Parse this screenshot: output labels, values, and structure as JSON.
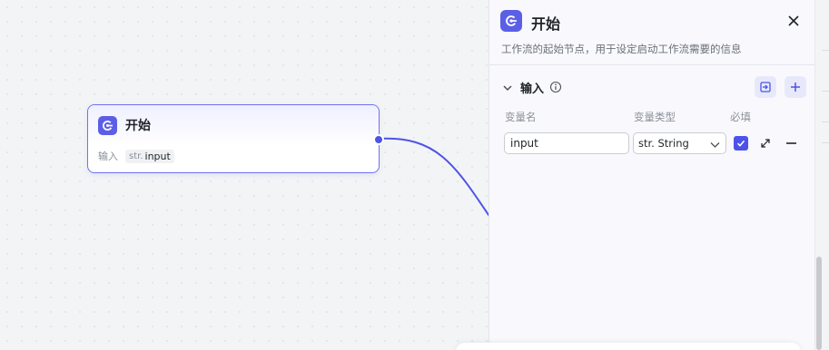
{
  "node": {
    "title": "开始",
    "input_label": "输入",
    "tag_type": "str.",
    "tag_name": "input"
  },
  "panel": {
    "title": "开始",
    "description": "工作流的起始节点，用于设定启动工作流需要的信息",
    "section_title": "输入",
    "columns": {
      "name": "变量名",
      "type": "变量类型",
      "required": "必填"
    },
    "variables": [
      {
        "name": "input",
        "type": "str. String",
        "required": true
      }
    ]
  },
  "colors": {
    "accent": "#4d53e8",
    "node_icon": "#5b5fe6",
    "edge": "#4d53e8"
  },
  "icons": {
    "node_icon": "start-node-icon",
    "close": "close-icon",
    "collapse": "chevron-down-icon",
    "info": "info-icon",
    "import": "import-icon",
    "add": "plus-icon",
    "expand": "expand-icon",
    "remove": "minus-icon"
  }
}
